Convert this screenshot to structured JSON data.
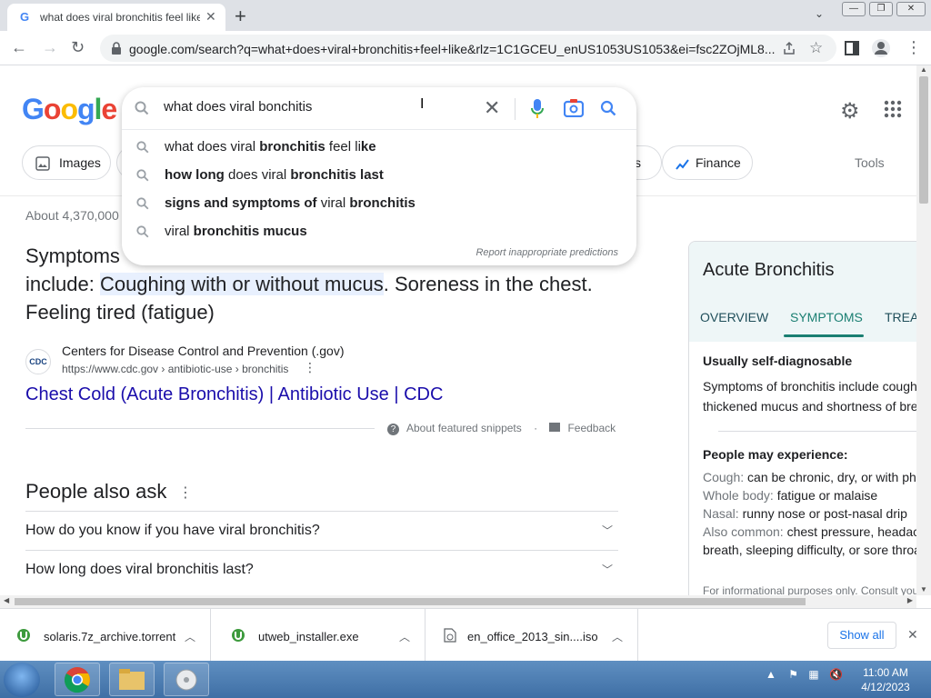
{
  "browser": {
    "tab_title": "what does viral bronchitis feel like",
    "tab_favicon": "G",
    "url": "google.com/search?q=what+does+viral+bronchitis+feel+like&rlz=1C1GCEU_enUS1053US1053&ei=fsc2ZOjML8..."
  },
  "search": {
    "query": "what does viral bonchitis",
    "suggestions": [
      {
        "parts": [
          [
            "what does viral ",
            false
          ],
          [
            "bronchitis",
            true
          ],
          [
            " feel li",
            false
          ],
          [
            "ke",
            true
          ]
        ]
      },
      {
        "parts": [
          [
            "how long",
            true
          ],
          [
            " does viral ",
            false
          ],
          [
            "bronchitis last",
            true
          ]
        ]
      },
      {
        "parts": [
          [
            "signs and symptoms of",
            true
          ],
          [
            " viral ",
            false
          ],
          [
            "bronchitis",
            true
          ]
        ]
      },
      {
        "parts": [
          [
            "viral ",
            false
          ],
          [
            "bronchitis mucus",
            true
          ]
        ]
      }
    ],
    "report_label": "Report inappropriate predictions"
  },
  "logo": [
    "G",
    "o",
    "o",
    "g",
    "l",
    "e"
  ],
  "logo_colors": [
    "#4285f4",
    "#ea4335",
    "#fbbc05",
    "#4285f4",
    "#34a853",
    "#ea4335"
  ],
  "chips": {
    "images": "Images",
    "finance": "Finance",
    "partial": "s",
    "tools": "Tools"
  },
  "results": {
    "about": "About 4,370,000",
    "snippet_line1_start": "Symptoms",
    "snippet_include": "include: ",
    "snippet_highlight": "Coughing with or without mucus",
    "snippet_rest": ". Soreness in the chest.",
    "snippet_line3": "Feeling tired (fatigue)",
    "site_logo": "CDC",
    "site_name": "Centers for Disease Control and Prevention (.gov)",
    "site_url": "https://www.cdc.gov › antibiotic-use › bronchitis",
    "link": "Chest Cold (Acute Bronchitis) | Antibiotic Use | CDC",
    "about_snippets": "About featured snippets",
    "feedback": "Feedback"
  },
  "paa": {
    "title": "People also ask",
    "questions": [
      "How do you know if you have viral bronchitis?",
      "How long does viral bronchitis last?"
    ]
  },
  "knowledge_panel": {
    "title": "Acute Bronchitis",
    "tabs": [
      "OVERVIEW",
      "SYMPTOMS",
      "TREA"
    ],
    "diagnosable": "Usually self-diagnosable",
    "desc": "Symptoms of bronchitis include cough, thickened mucus and shortness of breath.",
    "may_experience": "People may experience:",
    "symptoms": [
      {
        "label": "Cough:",
        "value": " can be chronic, dry, or with phlegm"
      },
      {
        "label": "Whole body:",
        "value": " fatigue or malaise"
      },
      {
        "label": "Nasal:",
        "value": " runny nose or post-nasal drip"
      },
      {
        "label": "Also common:",
        "value": " chest pressure, headache, shortness of"
      },
      {
        "label": "",
        "value": "breath, sleeping difficulty, or sore throat"
      }
    ],
    "footer": "For informational purposes only. Consult your"
  },
  "downloads": {
    "files": [
      "solaris.7z_archive.torrent",
      "utweb_installer.exe",
      "en_office_2013_sin....iso"
    ],
    "show_all": "Show all"
  },
  "taskbar": {
    "time": "11:00 AM",
    "date": "4/12/2023"
  }
}
